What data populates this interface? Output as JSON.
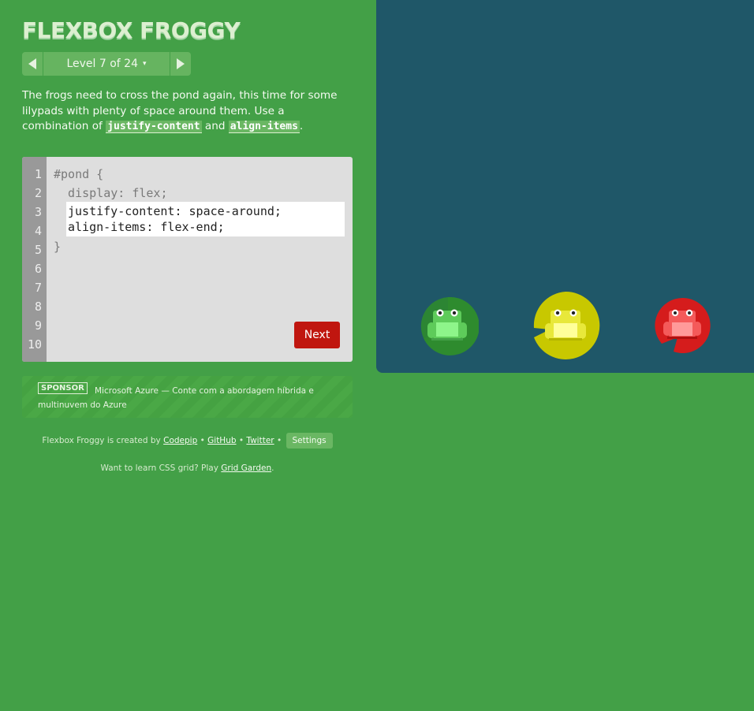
{
  "header": {
    "title": "FLEXBOX FROGGY"
  },
  "level_nav": {
    "label": "Level 7 of 24",
    "caret": "▾"
  },
  "instructions": {
    "text_before": "The frogs need to cross the pond again, this time for some lilypads with plenty of space around them. Use a combination of ",
    "code1": "justify-content",
    "text_middle": " and ",
    "code2": "align-items",
    "text_after": "."
  },
  "editor": {
    "line_numbers": [
      "1",
      "2",
      "3",
      "4",
      "5",
      "6",
      "7",
      "8",
      "9",
      "10"
    ],
    "line1": "#pond {",
    "line2": "  display: flex;",
    "input_line1": "justify-content: space-around;",
    "input_line2": "align-items: flex-end;",
    "line5": "}",
    "next_label": "Next"
  },
  "sponsor": {
    "badge": "SPONSOR",
    "text": "Microsoft Azure — Conte com a abordagem híbrida e multinuvem do Azure"
  },
  "footer": {
    "created_by": "Flexbox Froggy is created by",
    "codepip": "Codepip",
    "github": "GitHub",
    "twitter": "Twitter",
    "separator": "•",
    "settings": "Settings",
    "learn_text": "Want to learn CSS grid? Play",
    "grid_garden": "Grid Garden",
    "period": "."
  },
  "frogs": [
    {
      "color": "green",
      "pad_color": "#2e8b2e",
      "frog_color": "#5ecb5a",
      "belly_color": "#8ef58a"
    },
    {
      "color": "yellow",
      "pad_color": "#c8c800",
      "frog_color": "#e8e83a",
      "belly_color": "#ffff9a"
    },
    {
      "color": "red",
      "pad_color": "#d51c1c",
      "frog_color": "#f45a5a",
      "belly_color": "#ff9a9a"
    }
  ]
}
